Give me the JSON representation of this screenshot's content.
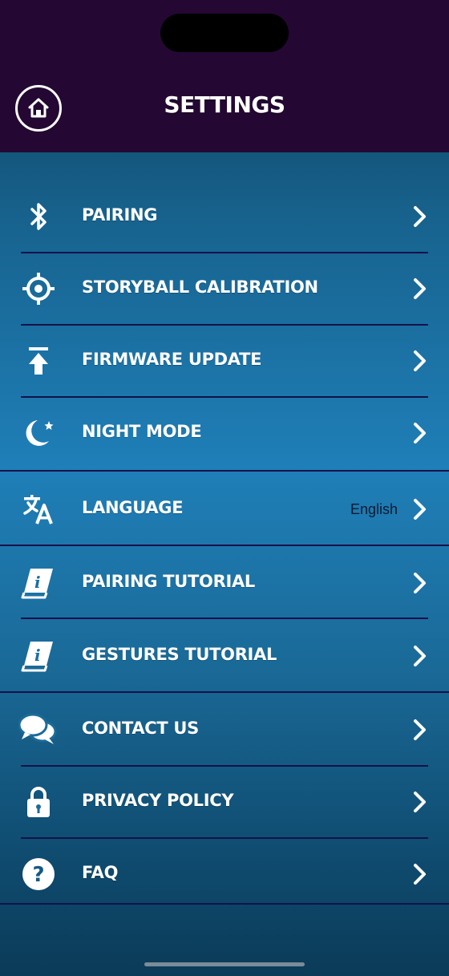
{
  "header": {
    "title": "SETTINGS",
    "home_icon": "home-icon"
  },
  "items": [
    {
      "label": "PAIRING",
      "icon": "bluetooth-icon",
      "value": ""
    },
    {
      "label": "STORYBALL CALIBRATION",
      "icon": "target-icon",
      "value": ""
    },
    {
      "label": "FIRMWARE UPDATE",
      "icon": "upload-icon",
      "value": ""
    },
    {
      "label": "NIGHT MODE",
      "icon": "moon-icon",
      "value": ""
    },
    {
      "label": "LANGUAGE",
      "icon": "translate-icon",
      "value": "English"
    },
    {
      "label": "PAIRING TUTORIAL",
      "icon": "info-book-icon",
      "value": ""
    },
    {
      "label": "GESTURES TUTORIAL",
      "icon": "info-book-icon",
      "value": ""
    },
    {
      "label": "CONTACT US",
      "icon": "chat-bubbles-icon",
      "value": ""
    },
    {
      "label": "PRIVACY POLICY",
      "icon": "lock-icon",
      "value": ""
    },
    {
      "label": "FAQ",
      "icon": "question-icon",
      "value": ""
    }
  ],
  "colors": {
    "header_bg": "#240833",
    "divider": "#14114a",
    "text": "#ffffff"
  }
}
